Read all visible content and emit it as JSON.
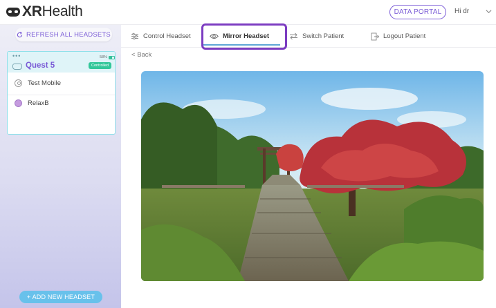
{
  "header": {
    "logo_bold": "XR",
    "logo_light": "Health",
    "data_portal_label": "DATA PORTAL",
    "user_greeting": "Hi dr"
  },
  "sidebar": {
    "refresh_label": "REFRESH ALL HEADSETS",
    "add_headset_label": "+ ADD NEW HEADSET",
    "headset": {
      "dots": "•••",
      "battery_text": "58%",
      "battery_level": 0.58,
      "name": "Quest 5",
      "status": "Controlled",
      "status_color": "#33c79a",
      "patient": "Test Mobile",
      "app": "RelaxB"
    }
  },
  "tabs": [
    {
      "label": "Control Headset",
      "icon": "sliders-icon"
    },
    {
      "label": "Mirror Headset",
      "icon": "eye-icon",
      "active": true
    },
    {
      "label": "Switch Patient",
      "icon": "swap-arrows-icon"
    },
    {
      "label": "Logout Patient",
      "icon": "logout-icon"
    }
  ],
  "back_label": "Back",
  "colors": {
    "accent": "#7a5bd6",
    "active_tab_underline": "#5ea6d6",
    "highlight_box": "#7c3cc1",
    "add_button": "#68c1eb"
  },
  "mirror_view": {
    "scene": "garden-bridge-vr-scene"
  }
}
